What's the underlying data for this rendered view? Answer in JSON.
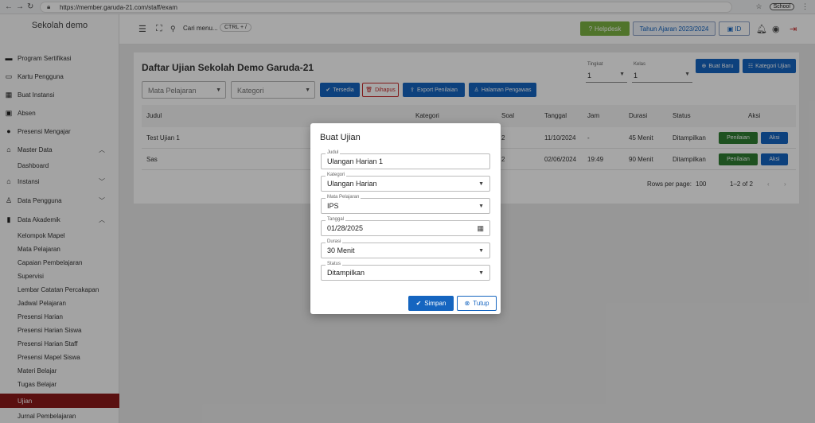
{
  "browser": {
    "url": "https://member.garuda-21.com/staff/exam",
    "profile": "School"
  },
  "sidebar": {
    "brand": "Sekolah demo",
    "items": [
      {
        "label": "Program Sertifikasi",
        "icon": "certificate-icon"
      },
      {
        "label": "Kartu Pengguna",
        "icon": "id-card-icon"
      },
      {
        "label": "Buat Instansi",
        "icon": "building-icon"
      },
      {
        "label": "Absen",
        "icon": "attendance-icon"
      },
      {
        "label": "Presensi Mengajar",
        "icon": "check-circle-icon"
      },
      {
        "label": "Master Data",
        "icon": "home-icon"
      },
      {
        "label": "Dashboard"
      },
      {
        "label": "Instansi",
        "icon": "institution-icon"
      },
      {
        "label": "Data Pengguna",
        "icon": "user-icon"
      },
      {
        "label": "Data Akademik",
        "icon": "book-icon"
      },
      {
        "label": "Kelompok Mapel"
      },
      {
        "label": "Mata Pelajaran"
      },
      {
        "label": "Capaian Pembelajaran"
      },
      {
        "label": "Supervisi"
      },
      {
        "label": "Lembar Catatan Percakapan"
      },
      {
        "label": "Jadwal Pelajaran"
      },
      {
        "label": "Presensi Harian"
      },
      {
        "label": "Presensi Harian Siswa"
      },
      {
        "label": "Presensi Harian Staff"
      },
      {
        "label": "Presensi Mapel Siswa"
      },
      {
        "label": "Materi Belajar"
      },
      {
        "label": "Tugas Belajar"
      },
      {
        "label": "Ujian"
      },
      {
        "label": "Jurnal Pembelajaran"
      }
    ]
  },
  "topbar": {
    "search_label": "Cari menu...",
    "shortcut": "CTRL + /",
    "helpdesk": "Helpdesk",
    "tahun_ajaran": "Tahun Ajaran 2023/2024",
    "lang": "ID"
  },
  "page": {
    "title": "Daftar Ujian Sekolah Demo Garuda-21",
    "tingkat_label": "Tingkat",
    "tingkat_value": "1",
    "kelas_label": "Kelas",
    "kelas_value": "1",
    "buat_baru": "Buat Baru",
    "kategori_ujian": "Kategori Ujian",
    "filter_mapel": "Mata Pelajaran",
    "filter_kategori": "Kategori",
    "btn_tersedia": "Tersedia",
    "btn_dihapus": "Dihapus",
    "btn_export": "Export Penilaian",
    "btn_pengawas": "Halaman Pengawas"
  },
  "table": {
    "headers": [
      "Judul",
      "Kategori",
      "Soal",
      "Tanggal",
      "Jam",
      "Durasi",
      "Status",
      "Aksi"
    ],
    "rows": [
      {
        "judul": "Test Ujian 1",
        "soal": "2",
        "tanggal": "11/10/2024",
        "jam": "-",
        "durasi": "45 Menit",
        "status": "Ditampilkan"
      },
      {
        "judul": "Sas",
        "soal": "2",
        "tanggal": "02/06/2024",
        "jam": "19:49",
        "durasi": "90 Menit",
        "status": "Ditampilkan"
      }
    ],
    "btn_penilaian": "Penilaian",
    "btn_aksi": "Aksi",
    "rows_per_page_label": "Rows per page:",
    "rows_per_page": "100",
    "range": "1–2 of 2"
  },
  "modal": {
    "title": "Buat Ujian",
    "fields": [
      {
        "label": "Judul",
        "value": "Ulangan Harian 1"
      },
      {
        "label": "Kategori",
        "value": "Ulangan Harian"
      },
      {
        "label": "Mata Pelajaran",
        "value": "IPS"
      },
      {
        "label": "Tanggal",
        "value": "01/28/2025"
      },
      {
        "label": "Durasi",
        "value": "30 Menit"
      },
      {
        "label": "Status",
        "value": "Ditampilkan"
      }
    ],
    "simpan": "Simpan",
    "tutup": "Tutup"
  },
  "colors": {
    "primary": "#1565c0",
    "active_sidebar": "#8b1a1a",
    "helpdesk": "#7cb342",
    "penilaian": "#2e7d32"
  }
}
